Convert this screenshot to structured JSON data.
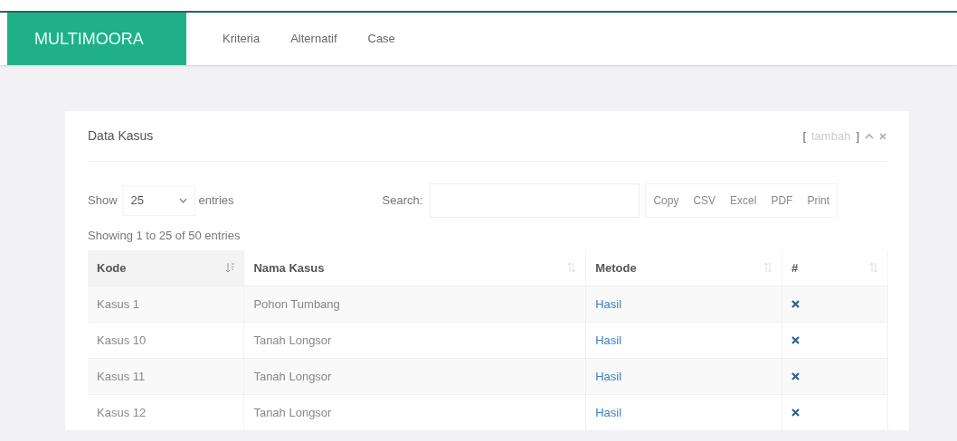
{
  "brand": "MULTIMOORA",
  "nav": [
    {
      "label": "Kriteria"
    },
    {
      "label": "Alternatif"
    },
    {
      "label": "Case"
    }
  ],
  "card": {
    "title": "Data Kasus",
    "add_link": "tambah",
    "bracket_open": "[",
    "bracket_close": "]"
  },
  "length": {
    "label_before": "Show",
    "value": "25",
    "label_after": "entries"
  },
  "search": {
    "label": "Search:"
  },
  "export_buttons": [
    "Copy",
    "CSV",
    "Excel",
    "PDF",
    "Print"
  ],
  "info": "Showing 1 to 25 of 50 entries",
  "table": {
    "columns": [
      {
        "label": "Kode",
        "sorted": true
      },
      {
        "label": "Nama Kasus",
        "sorted": false
      },
      {
        "label": "Metode",
        "sorted": false
      },
      {
        "label": "#",
        "sorted": false
      }
    ],
    "rows": [
      {
        "kode": "Kasus 1",
        "nama": "Pohon Tumbang",
        "metode": "Hasil"
      },
      {
        "kode": "Kasus 10",
        "nama": "Tanah Longsor",
        "metode": "Hasil"
      },
      {
        "kode": "Kasus 11",
        "nama": "Tanah Longsor",
        "metode": "Hasil"
      },
      {
        "kode": "Kasus 12",
        "nama": "Tanah Longsor",
        "metode": "Hasil"
      }
    ]
  }
}
